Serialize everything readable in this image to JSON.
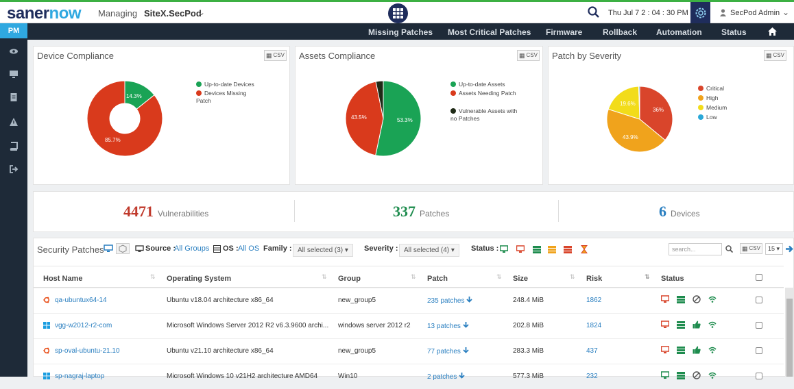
{
  "topbar": {
    "logo_a": "saner",
    "logo_b": "now",
    "managing": "Managing",
    "site": "SiteX.SecPod",
    "datetime": "Thu Jul 7  2 : 04 : 30 PM",
    "user": "SecPod Admin"
  },
  "sidebar": {
    "pm": "PM"
  },
  "nav": [
    "Missing Patches",
    "Most Critical Patches",
    "Firmware",
    "Rollback",
    "Automation",
    "Status"
  ],
  "csv_label": "CSV",
  "cards": {
    "device": {
      "title": "Device Compliance",
      "legend": [
        "Up-to-date Devices",
        "Devices Missing Patch"
      ],
      "labels": [
        "14.3%",
        "85.7%"
      ]
    },
    "assets": {
      "title": "Assets Compliance",
      "legend": [
        "Up-to-date Assets",
        "Assets Needing Patch",
        "Vulnerable Assets with no Patches"
      ],
      "labels": [
        "53.3%",
        "43.5%"
      ]
    },
    "severity": {
      "title": "Patch by Severity",
      "legend": [
        "Critical",
        "High",
        "Medium",
        "Low"
      ],
      "labels": [
        "36%",
        "43.9%",
        "19.6%"
      ]
    }
  },
  "chart_data": [
    {
      "type": "pie",
      "title": "Device Compliance",
      "categories": [
        "Up-to-date Devices",
        "Devices Missing Patch"
      ],
      "values": [
        14.3,
        85.7
      ],
      "colors": [
        "#1aa355",
        "#d93a1c"
      ]
    },
    {
      "type": "pie",
      "title": "Assets Compliance",
      "categories": [
        "Up-to-date Assets",
        "Assets Needing Patch",
        "Vulnerable Assets with no Patches"
      ],
      "values": [
        53.3,
        43.5,
        3.2
      ],
      "colors": [
        "#1aa355",
        "#d93a1c",
        "#1f2a16"
      ]
    },
    {
      "type": "pie",
      "title": "Patch by Severity",
      "categories": [
        "Critical",
        "High",
        "Medium",
        "Low"
      ],
      "values": [
        36,
        43.9,
        19.6,
        0.5
      ],
      "colors": [
        "#d9452b",
        "#f0a31c",
        "#f2dc1a",
        "#2aa8d8"
      ]
    }
  ],
  "stats": [
    {
      "value": "4471",
      "label": "Vulnerabilities",
      "color": "#c0392b"
    },
    {
      "value": "337",
      "label": "Patches",
      "color": "#1e8c4e"
    },
    {
      "value": "6",
      "label": "Devices",
      "color": "#2a7fc0"
    }
  ],
  "filters": {
    "title": "Security Patches",
    "source_label": "Source :",
    "source_value": "All Groups",
    "os_label": "OS :",
    "os_value": "All OS",
    "family_label": "Family :",
    "family_value": "All selected (3)",
    "severity_label": "Severity :",
    "severity_value": "All selected (4)",
    "status_label": "Status :",
    "search_placeholder": "search...",
    "page_size": "15"
  },
  "table": {
    "headers": [
      "Host Name",
      "Operating System",
      "Group",
      "Patch",
      "Size",
      "Risk",
      "Status"
    ],
    "rows": [
      {
        "host": "qa-ubuntux64-14",
        "os": "Ubuntu v18.04 architecture x86_64",
        "group": "new_group5",
        "patch": "235 patches",
        "size": "248.4 MiB",
        "risk": "1862",
        "icon": "ubuntu-icon"
      },
      {
        "host": "vgg-w2012-r2-com",
        "os": "Microsoft Windows Server 2012 R2 v6.3.9600 archi...",
        "group": "windows server 2012 r2",
        "patch": "13 patches",
        "size": "202.8 MiB",
        "risk": "1824",
        "icon": "windows-icon"
      },
      {
        "host": "sp-oval-ubuntu-21.10",
        "os": "Ubuntu v21.10 architecture x86_64",
        "group": "new_group5",
        "patch": "77 patches",
        "size": "283.3 MiB",
        "risk": "437",
        "icon": "ubuntu-icon"
      },
      {
        "host": "sp-nagraj-laptop",
        "os": "Microsoft Windows 10 v21H2 architecture AMD64",
        "group": "Win10",
        "patch": "2 patches",
        "size": "577.3 MiB",
        "risk": "232",
        "icon": "windows-icon"
      }
    ]
  }
}
